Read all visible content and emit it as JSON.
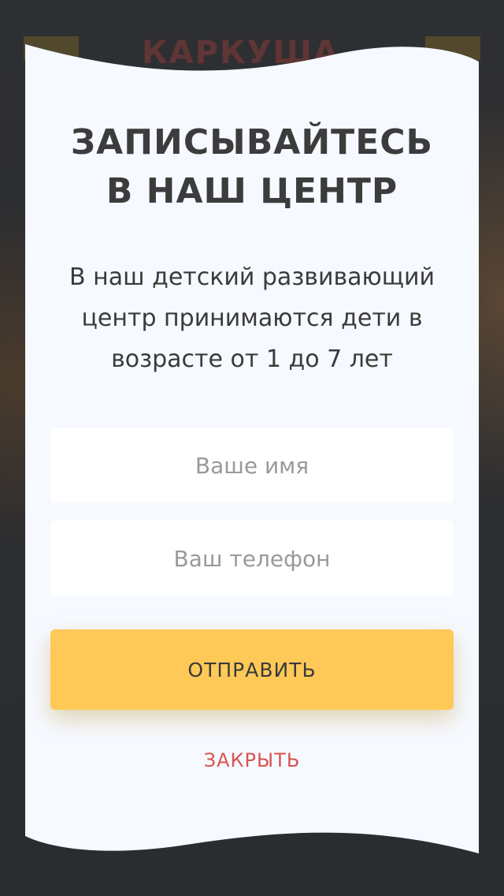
{
  "background": {
    "logo_text": "КАРКУША"
  },
  "modal": {
    "title": "ЗАПИСЫВАЙТЕСЬ\nВ НАШ ЦЕНТР",
    "description": "В наш детский развивающий\nцентр принимаются дети в\nвозрасте от 1 до 7 лет",
    "name_field": {
      "value": "",
      "placeholder": "Ваше имя"
    },
    "phone_field": {
      "value": "",
      "placeholder": "Ваш телефон"
    },
    "submit_label": "ОТПРАВИТЬ",
    "close_label": "ЗАКРЫТЬ"
  },
  "colors": {
    "overlay": "#2b2d30",
    "modal_background": "#f6f9ff",
    "field_background": "#ffffff",
    "submit_background": "#ffc957",
    "close_text": "#d9534f",
    "title_text": "#3c3c3c"
  }
}
